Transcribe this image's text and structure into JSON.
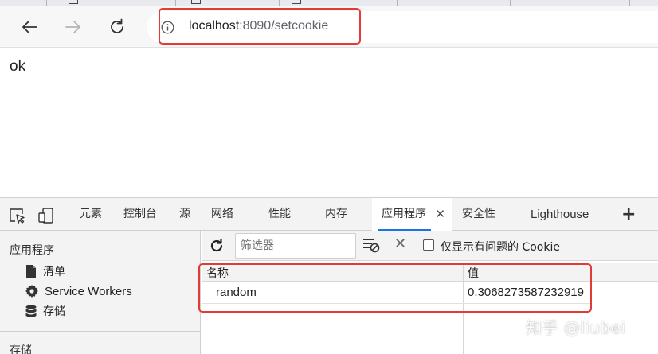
{
  "browser": {
    "address": {
      "host": "localhost",
      "rest": ":8090/setcookie"
    }
  },
  "page": {
    "body_text": "ok"
  },
  "devtools": {
    "tabs": [
      {
        "label": "元素"
      },
      {
        "label": "控制台"
      },
      {
        "label": "源"
      },
      {
        "label": "网络"
      },
      {
        "label": "性能"
      },
      {
        "label": "内存"
      },
      {
        "label": "应用程序",
        "active": true
      },
      {
        "label": "安全性"
      },
      {
        "label": "Lighthouse"
      }
    ],
    "add_tab_label": "+",
    "sidebar": {
      "title": "应用程序",
      "items": [
        {
          "label": "清单",
          "icon": "document-icon"
        },
        {
          "label": "Service Workers",
          "icon": "gear-icon"
        },
        {
          "label": "存储",
          "icon": "database-icon"
        }
      ],
      "section_title": "存储"
    },
    "cookies": {
      "filter_placeholder": "筛选器",
      "only_issues_label": "仅显示有问题的 Cookie",
      "columns": [
        "名称",
        "值"
      ],
      "rows": [
        {
          "name": "random",
          "value": "0.3068273587232919"
        }
      ]
    }
  },
  "watermark": "知乎 @liubei",
  "colors": {
    "highlight": "#e53935",
    "active_tab_underline": "#1a73e8"
  }
}
